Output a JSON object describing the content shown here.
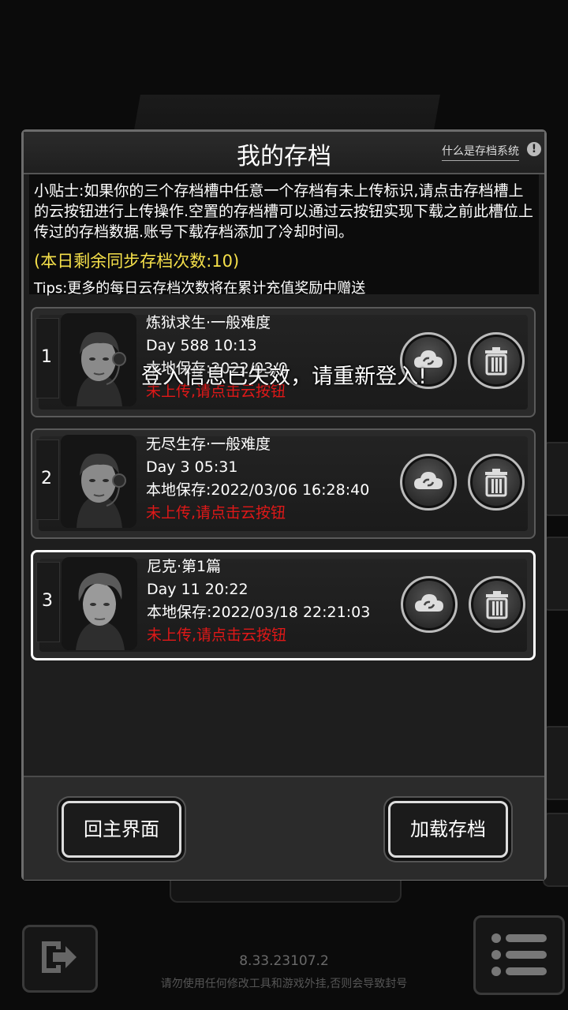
{
  "dialog": {
    "title": "我的存档",
    "help_link": "什么是存档系统",
    "help_icon": "!"
  },
  "tips": {
    "main": "小贴士:如果你的三个存档槽中任意一个存档有未上传标识,请点击存档槽上的云按钮进行上传操作.空置的存档槽可以通过云按钮实现下载之前此槽位上传过的存档数据.账号下载存档添加了冷却时间。",
    "count": "(本日剩余同步存档次数:10)",
    "extra": "Tips:更多的每日云存档次数将在累计充值奖励中赠送"
  },
  "slots": [
    {
      "num": "1",
      "mode": "炼狱求生·一般难度",
      "day": "Day 588  10:13",
      "local": "本地保存:2022/03/0",
      "status": "未上传,请点击云按钮",
      "portrait": "survivor-headset-avatar"
    },
    {
      "num": "2",
      "mode": "无尽生存·一般难度",
      "day": "Day 3  05:31",
      "local": "本地保存:2022/03/06  16:28:40",
      "status": "未上传,请点击云按钮",
      "portrait": "survivor-headset-avatar"
    },
    {
      "num": "3",
      "mode": "尼克·第1篇",
      "day": "Day 11  20:22",
      "local": "本地保存:2022/03/18  22:21:03",
      "status": "未上传,请点击云按钮",
      "portrait": "nick-avatar"
    }
  ],
  "toast": "登入信息已失效，请重新登入!",
  "footer": {
    "home_label": "回主界面",
    "load_label": "加载存档"
  },
  "version": "8.33.23107.2",
  "warning": "请勿使用任何修改工具和游戏外挂,否则会导致封号",
  "icons": {
    "cloud": "cloud-sync-icon",
    "trash": "trash-icon",
    "exit": "exit-icon",
    "menu": "menu-list-icon"
  },
  "colors": {
    "status_red": "#e01818",
    "count_yellow": "#f5e04a"
  }
}
